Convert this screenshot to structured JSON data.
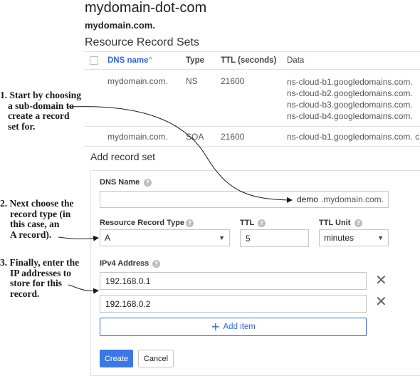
{
  "page": {
    "title": "mydomain-dot-com",
    "zone_name": "mydomain.com.",
    "section_title": "Resource Record Sets"
  },
  "table": {
    "columns": {
      "dns_name": "DNS name",
      "sort_indicator": "^",
      "type": "Type",
      "ttl": "TTL (seconds)",
      "data": "Data"
    },
    "rows": [
      {
        "dns_name": "mydomain.com.",
        "type": "NS",
        "ttl": "21600",
        "data": [
          "ns-cloud-b1.googledomains.com.",
          "ns-cloud-b2.googledomains.com.",
          "ns-cloud-b3.googledomains.com.",
          "ns-cloud-b4.googledomains.com."
        ]
      },
      {
        "dns_name": "mydomain.com.",
        "type": "SOA",
        "ttl": "21600",
        "data": [
          "ns-cloud-b1.googledomains.com. c"
        ]
      }
    ]
  },
  "form": {
    "title": "Add record set",
    "help_glyph": "?",
    "dns_name": {
      "label": "DNS Name",
      "value": "demo",
      "suffix": ".mydomain.com."
    },
    "record_type": {
      "label": "Resource Record Type",
      "selected": "A"
    },
    "ttl": {
      "label": "TTL",
      "value": "5"
    },
    "ttl_unit": {
      "label": "TTL Unit",
      "selected": "minutes"
    },
    "ipv4": {
      "label": "IPv4 Address",
      "addresses": [
        "192.168.0.1",
        "192.168.0.2"
      ],
      "remove_glyph": "✕"
    },
    "add_item_label": "Add item",
    "add_item_glyph": "+",
    "create_label": "Create",
    "cancel_label": "Cancel"
  },
  "annotations": {
    "note1": [
      "1. Start by choosing",
      "a sub-domain to",
      "create a record",
      "set for."
    ],
    "note2": [
      "2. Next choose the",
      "record type (in",
      "this case, an",
      "A record)."
    ],
    "note3": [
      "3. Finally, enter the",
      "IP addresses to",
      "store for this",
      "record."
    ]
  },
  "colors": {
    "accent": "#3367d6",
    "primary_button": "#3b78e7",
    "text": "#212121",
    "border": "#e0e0e0"
  }
}
